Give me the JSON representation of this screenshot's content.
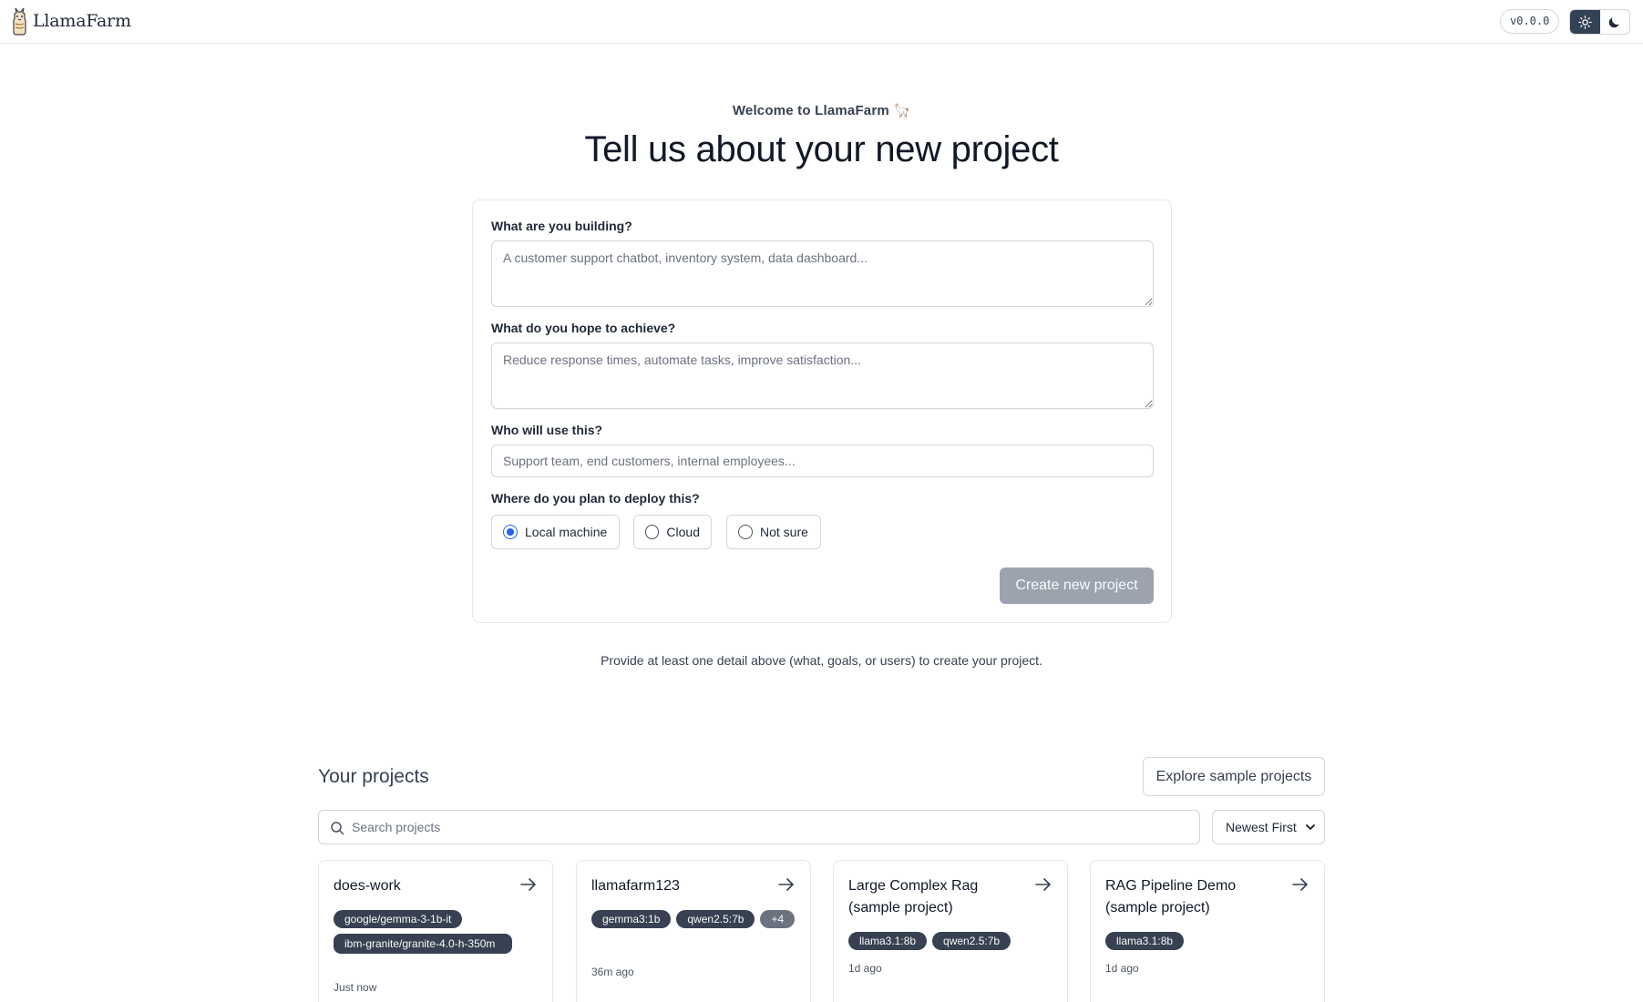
{
  "header": {
    "brand": "LlamaFarm",
    "version": "v0.0.0",
    "theme": {
      "light_icon": "sun-icon",
      "dark_icon": "moon-icon",
      "active": "light"
    }
  },
  "hero": {
    "welcome": "Welcome to LlamaFarm 🦙",
    "title": "Tell us about your new project"
  },
  "form": {
    "what_label": "What are you building?",
    "what_placeholder": "A customer support chatbot, inventory system, data dashboard...",
    "goals_label": "What do you hope to achieve?",
    "goals_placeholder": "Reduce response times, automate tasks, improve satisfaction...",
    "users_label": "Who will use this?",
    "users_placeholder": "Support team, end customers, internal employees...",
    "deploy_label": "Where do you plan to deploy this?",
    "deploy_options": [
      {
        "label": "Local machine",
        "checked": true
      },
      {
        "label": "Cloud",
        "checked": false
      },
      {
        "label": "Not sure",
        "checked": false
      }
    ],
    "submit_label": "Create new project"
  },
  "hint": "Provide at least one detail above (what, goals, or users) to create your project.",
  "projects": {
    "title": "Your projects",
    "explore_label": "Explore sample projects",
    "search_placeholder": "Search projects",
    "sort_value": "Newest First",
    "items": [
      {
        "name": "does-work",
        "tags": [
          "google/gemma-3-1b-it",
          "ibm-granite/granite-4.0-h-350m"
        ],
        "time": "Just now"
      },
      {
        "name": "llamafarm123",
        "tags": [
          "gemma3:1b",
          "qwen2.5:7b",
          "+4"
        ],
        "time": "36m ago"
      },
      {
        "name": "Large Complex Rag (sample project)",
        "tags": [
          "llama3.1:8b",
          "qwen2.5:7b"
        ],
        "time": "1d ago"
      },
      {
        "name": "RAG Pipeline Demo (sample project)",
        "tags": [
          "llama3.1:8b"
        ],
        "time": "1d ago"
      }
    ]
  },
  "colors": {
    "accent": "#2563eb",
    "tag_bg": "#374151",
    "disabled_button": "#9ca3af"
  }
}
